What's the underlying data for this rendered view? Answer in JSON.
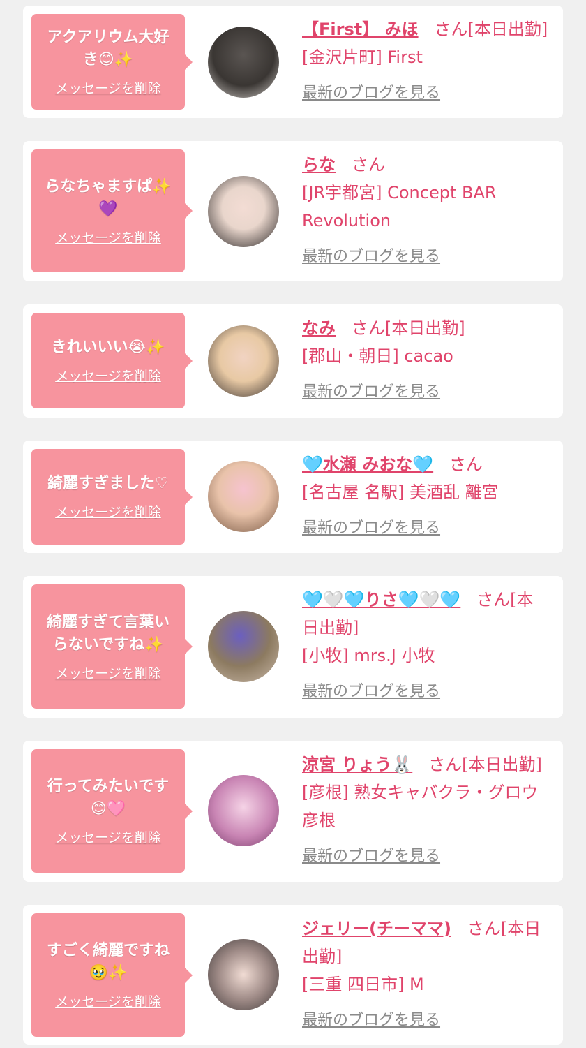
{
  "cards": [
    {
      "message": "アクアリウム大好き😊✨",
      "delete_label": "メッセージを削除",
      "name": "【First】 みほ",
      "honorific": "さん[本日出勤]",
      "shop": "[金沢片町] First",
      "blog_label": "最新のブログを見る",
      "avatar_icon": "avatar-photo-icon"
    },
    {
      "message": "らなちゃますぱ✨💜",
      "delete_label": "メッセージを削除",
      "name": "らな",
      "honorific": "さん",
      "shop": "[JR宇都宮] Concept BAR Revolution",
      "blog_label": "最新のブログを見る",
      "avatar_icon": "avatar-photo-icon"
    },
    {
      "message": "きれいいい😭✨",
      "delete_label": "メッセージを削除",
      "name": "なみ",
      "honorific": "さん[本日出勤]",
      "shop": "[郡山・朝日] cacao",
      "blog_label": "最新のブログを見る",
      "avatar_icon": "avatar-photo-icon"
    },
    {
      "message": "綺麗すぎました♡",
      "delete_label": "メッセージを削除",
      "name": "🩵水瀬 みおな🩵",
      "honorific": "さん",
      "shop": "[名古屋 名駅] 美酒乱 離宮",
      "blog_label": "最新のブログを見る",
      "avatar_icon": "avatar-photo-icon"
    },
    {
      "message": "綺麗すぎて言葉いらないですね✨",
      "delete_label": "メッセージを削除",
      "name": "🩵🤍🩵りさ🩵🤍🩵",
      "honorific": "さん[本日出勤]",
      "shop": "[小牧] mrs.J 小牧",
      "blog_label": "最新のブログを見る",
      "avatar_icon": "avatar-photo-icon"
    },
    {
      "message": "行ってみたいです😊🩷",
      "delete_label": "メッセージを削除",
      "name": "涼宮 りょう🐰",
      "honorific": "さん[本日出勤]",
      "shop": "[彦根] 熟女キャバクラ・グロウ彦根",
      "blog_label": "最新のブログを見る",
      "avatar_icon": "avatar-photo-icon"
    },
    {
      "message": "すごく綺麗ですね🥹✨",
      "delete_label": "メッセージを削除",
      "name": "ジェリー(チーママ)",
      "honorific": "さん[本日出勤]",
      "shop": "[三重 四日市] M",
      "blog_label": "最新のブログを見る",
      "avatar_icon": "avatar-photo-icon"
    }
  ],
  "colors": {
    "page_background": "#f0f0f0",
    "card_background": "#ffffff",
    "bubble": "#f7949e",
    "accent_text": "#e0446b",
    "link_gray": "#8a8a8a"
  }
}
